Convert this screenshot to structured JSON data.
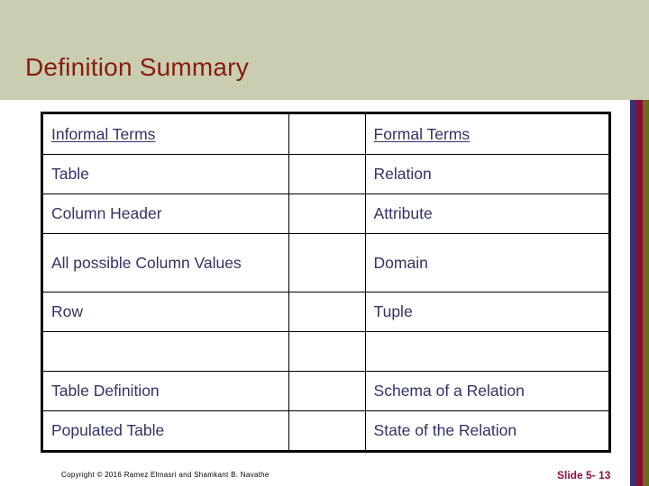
{
  "slide": {
    "title": "Definition Summary",
    "background_color": "#c9ceb0",
    "title_color": "#8b1a0e",
    "body_text_color": "#333366"
  },
  "table": {
    "columns": [
      {
        "key": "informal",
        "header": "Informal Terms"
      },
      {
        "key": "gap",
        "header": ""
      },
      {
        "key": "formal",
        "header": "Formal Terms"
      }
    ],
    "rows": [
      {
        "informal": "Table",
        "gap": "",
        "formal": "Relation"
      },
      {
        "informal": "Column Header",
        "gap": "",
        "formal": "Attribute"
      },
      {
        "informal": "All possible Column Values",
        "gap": "",
        "formal": "Domain"
      },
      {
        "informal": "Row",
        "gap": "",
        "formal": "Tuple"
      },
      {
        "informal": "",
        "gap": "",
        "formal": ""
      },
      {
        "informal": "Table Definition",
        "gap": "",
        "formal": "Schema of a Relation"
      },
      {
        "informal": "Populated Table",
        "gap": "",
        "formal": "State of the Relation"
      }
    ]
  },
  "footer": {
    "copyright": "Copyright © 2016 Ramez Elmasri and Shamkant B. Navathe",
    "slide_number": "Slide 5- 13",
    "slide_number_color": "#8e1038"
  },
  "decoration": {
    "stripes": [
      {
        "name": "navy",
        "color": "#3b3178"
      },
      {
        "name": "maroon",
        "color": "#8e0b31"
      },
      {
        "name": "olive",
        "color": "#6b6b1e"
      }
    ]
  }
}
